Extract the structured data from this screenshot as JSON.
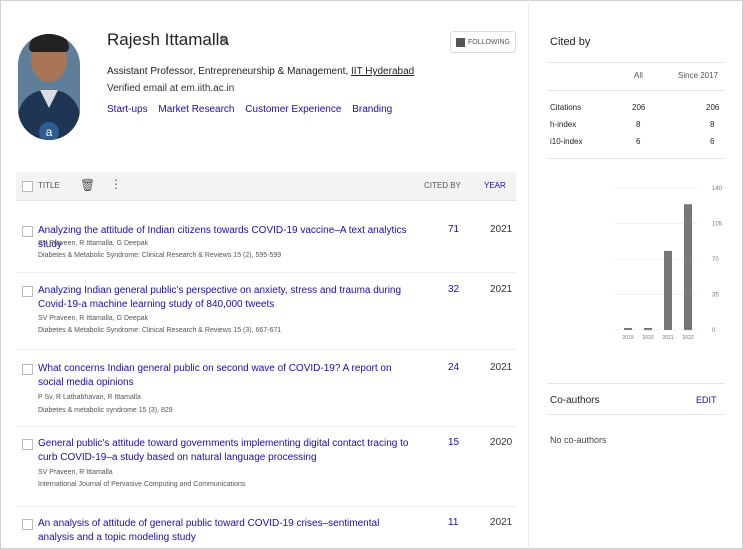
{
  "profile": {
    "name": "Rajesh Ittamalla",
    "affiliation_prefix": "Assistant Professor, Entrepreneurship & Management, ",
    "affiliation_link": "IIT Hyderabad",
    "verified": "Verified email at em.iith.ac.in",
    "interests": [
      "Start-ups",
      "Market Research",
      "Customer Experience",
      "Branding"
    ],
    "follow_label": "FOLLOWING",
    "avatar_badge": "a"
  },
  "table": {
    "title_header": "TITLE",
    "cited_header": "CITED BY",
    "year_header": "YEAR"
  },
  "articles": [
    {
      "title": "Analyzing the attitude of Indian citizens towards COVID-19 vaccine–A text analytics study",
      "authors": "SV Praveen, R Ittamalla, G Deepak",
      "venue": "Diabetes & Metabolic Syndrome: Clinical Research & Reviews 15 (2), 595-599",
      "cited": "71",
      "year": "2021"
    },
    {
      "title": "Analyzing Indian general public's perspective on anxiety, stress and trauma during Covid-19-a machine learning study of 840,000 tweets",
      "authors": "SV Praveen, R Ittamalla, G Deepak",
      "venue": "Diabetes & Metabolic Syndrome: Clinical Research & Reviews 15 (3), 667-671",
      "cited": "32",
      "year": "2021"
    },
    {
      "title": "What concerns Indian general public on second wave of COVID-19? A report on social media opinions",
      "authors": "P Sv, R Lathabhavan, R Ittamalla",
      "venue": "Diabetes & metabolic syndrome 15 (3), 829",
      "cited": "24",
      "year": "2021"
    },
    {
      "title": "General public's attitude toward governments implementing digital contact tracing to curb COVID-19–a study based on natural language processing",
      "authors": "SV Praveen, R Ittamalla",
      "venue": "International Journal of Pervasive Computing and Communications",
      "cited": "15",
      "year": "2020"
    },
    {
      "title": "An analysis of attitude of general public toward COVID-19 crises–sentimental analysis and a topic modeling study",
      "authors": "",
      "venue": "",
      "cited": "11",
      "year": "2021"
    }
  ],
  "cited_by": {
    "title": "Cited by",
    "col_all": "All",
    "col_since": "Since 2017",
    "rows": [
      {
        "label": "Citations",
        "all": "206",
        "since": "206"
      },
      {
        "label": "h-index",
        "all": "8",
        "since": "8"
      },
      {
        "label": "i10-index",
        "all": "6",
        "since": "6"
      }
    ]
  },
  "chart_data": {
    "type": "bar",
    "categories": [
      "2019",
      "2020",
      "2021",
      "2022"
    ],
    "values": [
      2,
      2,
      78,
      124
    ],
    "ylim": [
      0,
      140
    ],
    "yticks": [
      "0",
      "35",
      "70",
      "105",
      "140"
    ]
  },
  "coauthors": {
    "title": "Co-authors",
    "edit_label": "EDIT",
    "empty_text": "No co-authors"
  }
}
